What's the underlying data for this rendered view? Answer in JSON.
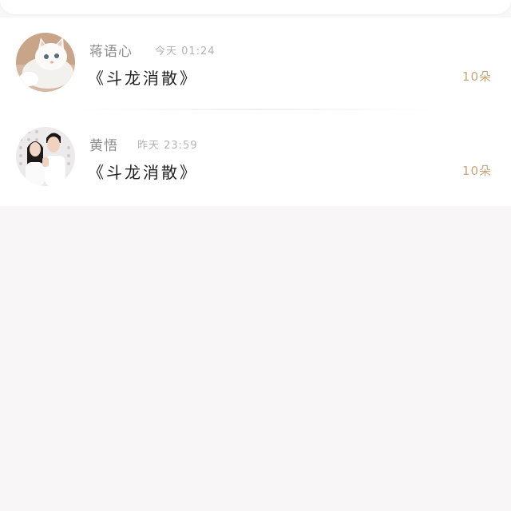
{
  "records": [
    {
      "name": "蒋语心",
      "time": "今天 01:24",
      "gift": "《斗龙消散》",
      "count": "10朵",
      "avatar_icon": "white-kitten-photo"
    },
    {
      "name": "黄悟",
      "time": "昨天 23:59",
      "gift": "《斗龙消散》",
      "count": "10朵",
      "avatar_icon": "couple-photo"
    }
  ],
  "colors": {
    "count_accent": "#c9a57a",
    "background": "#f8f6f6"
  }
}
